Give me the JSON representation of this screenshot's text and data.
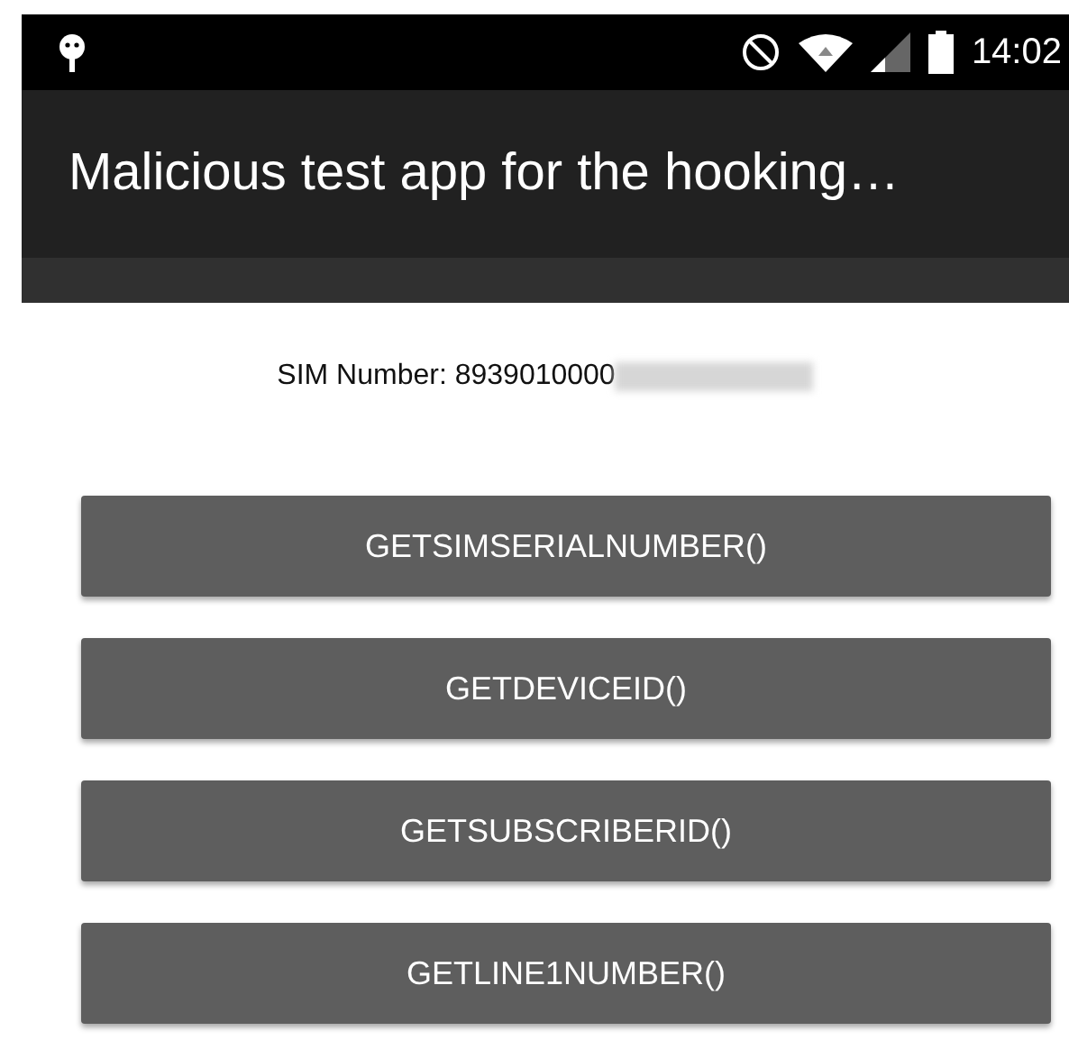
{
  "status_bar": {
    "time": "14:02"
  },
  "app_bar": {
    "title": "Malicious test app for the hooking…"
  },
  "sim_label": "SIM Number: 8939010000",
  "buttons": [
    {
      "label": "GETSIMSERIALNUMBER()"
    },
    {
      "label": "GETDEVICEID()"
    },
    {
      "label": "GETSUBSCRIBERID()"
    },
    {
      "label": "GETLINE1NUMBER()"
    }
  ]
}
